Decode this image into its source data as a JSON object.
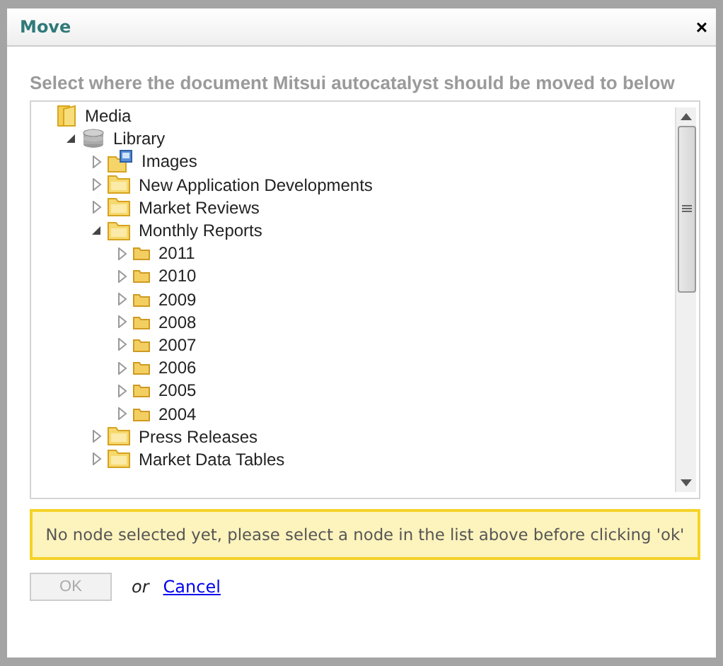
{
  "dialog": {
    "title": "Move",
    "close": "×"
  },
  "heading": "Select where the document Mitsui autocatalyst should be moved to below",
  "tree": [
    {
      "label": "Media",
      "kind": "root",
      "children": [
        {
          "label": "Library",
          "kind": "database",
          "expanded": true,
          "children": [
            {
              "label": "Images",
              "kind": "image-folder",
              "expanded": false
            },
            {
              "label": "New Application Developments",
              "kind": "folder",
              "expanded": false
            },
            {
              "label": "Market Reviews",
              "kind": "folder",
              "expanded": false
            },
            {
              "label": "Monthly Reports",
              "kind": "folder",
              "expanded": true,
              "children": [
                {
                  "label": "2011",
                  "kind": "small-folder",
                  "expanded": false
                },
                {
                  "label": "2010",
                  "kind": "small-folder",
                  "expanded": false
                },
                {
                  "label": "2009",
                  "kind": "small-folder",
                  "expanded": false
                },
                {
                  "label": "2008",
                  "kind": "small-folder",
                  "expanded": false
                },
                {
                  "label": "2007",
                  "kind": "small-folder",
                  "expanded": false
                },
                {
                  "label": "2006",
                  "kind": "small-folder",
                  "expanded": false
                },
                {
                  "label": "2005",
                  "kind": "small-folder",
                  "expanded": false
                },
                {
                  "label": "2004",
                  "kind": "small-folder",
                  "expanded": false
                }
              ]
            },
            {
              "label": "Press Releases",
              "kind": "folder",
              "expanded": false
            },
            {
              "label": "Market Data Tables",
              "kind": "folder",
              "expanded": false
            }
          ]
        }
      ]
    }
  ],
  "warning": "No node selected yet, please select a node in the list above before clicking 'ok'",
  "actions": {
    "ok": {
      "label": "OK",
      "disabled": true
    },
    "separator": "or",
    "cancel": "Cancel"
  }
}
